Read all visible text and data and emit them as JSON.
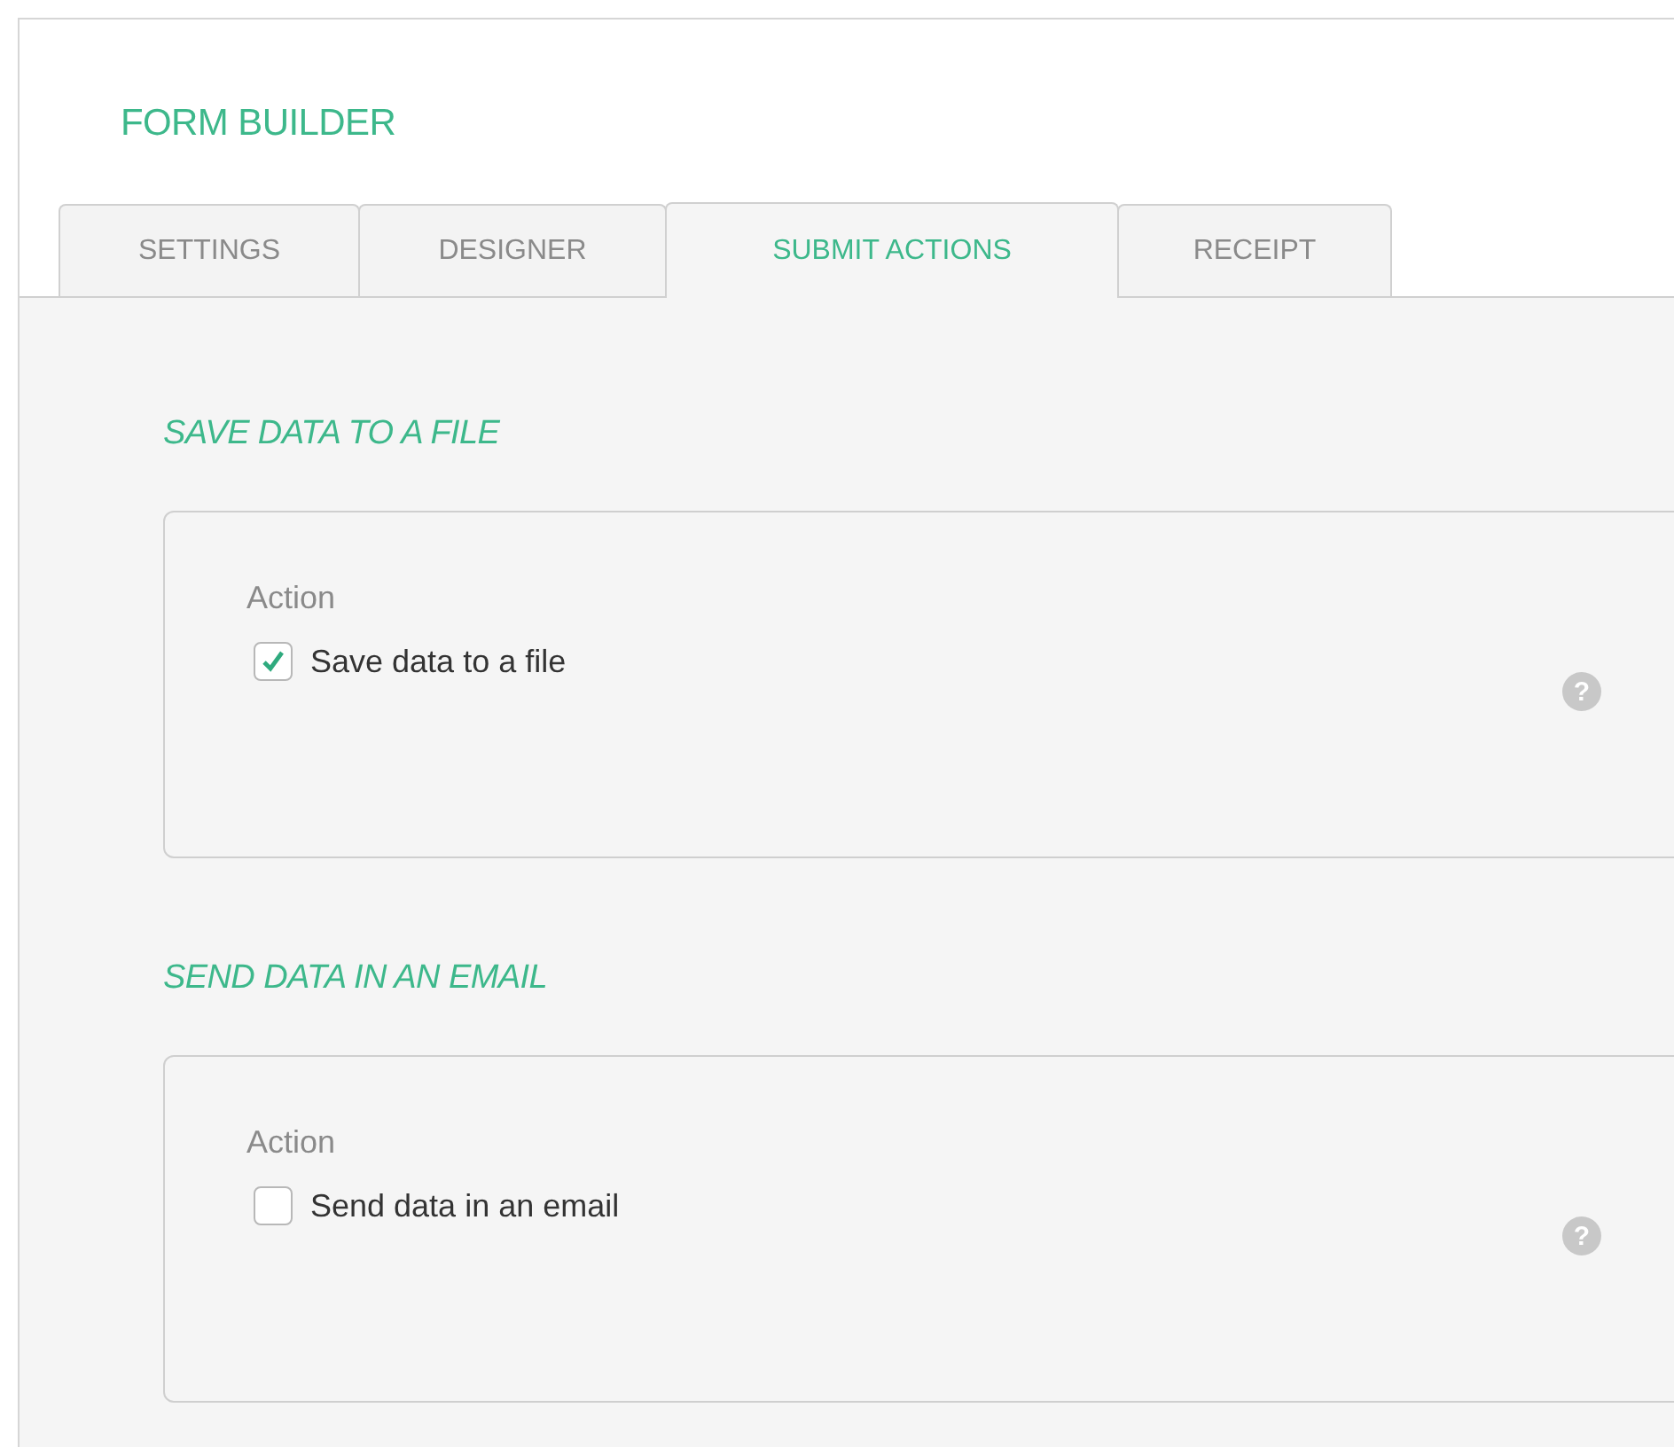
{
  "title": "FORM BUILDER",
  "tabs": [
    {
      "label": "SETTINGS",
      "selected": false
    },
    {
      "label": "DESIGNER",
      "selected": false
    },
    {
      "label": "SUBMIT ACTIONS",
      "selected": true
    },
    {
      "label": "RECEIPT",
      "selected": false
    }
  ],
  "sections": [
    {
      "heading": "SAVE DATA TO A FILE",
      "field_label": "Action",
      "checkbox_label": "Save data to a file",
      "checked": true,
      "help": "?"
    },
    {
      "heading": "SEND DATA IN AN EMAIL",
      "field_label": "Action",
      "checkbox_label": "Send data in an email",
      "checked": false,
      "help": "?"
    }
  ]
}
